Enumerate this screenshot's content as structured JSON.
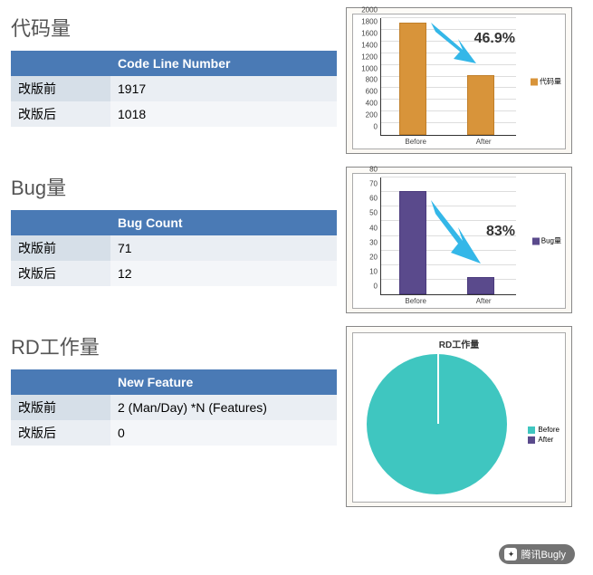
{
  "sections": {
    "code": {
      "title": "代码量",
      "header": "Code Line Number",
      "row1_label": "改版前",
      "row1_value": "1917",
      "row2_label": "改版后",
      "row2_value": "1018"
    },
    "bug": {
      "title": "Bug量",
      "header": "Bug Count",
      "row1_label": "改版前",
      "row1_value": "71",
      "row2_label": "改版后",
      "row2_value": "12"
    },
    "rd": {
      "title": "RD工作量",
      "header": "New Feature",
      "row1_label": "改版前",
      "row1_value": "2 (Man/Day) *N (Features)",
      "row2_label": "改版后",
      "row2_value": "0"
    }
  },
  "chart_data": [
    {
      "type": "bar",
      "categories": [
        "Before",
        "After"
      ],
      "values": [
        1917,
        1018
      ],
      "legend": "代码量",
      "ylim": [
        0,
        2000
      ],
      "yticks": [
        0,
        200,
        400,
        600,
        800,
        1000,
        1200,
        1400,
        1600,
        1800,
        2000
      ],
      "callout": "46.9%",
      "color": "#D8943A"
    },
    {
      "type": "bar",
      "categories": [
        "Before",
        "After"
      ],
      "values": [
        71,
        12
      ],
      "legend": "Bug量",
      "ylim": [
        0,
        80
      ],
      "yticks": [
        0,
        10,
        20,
        30,
        40,
        50,
        60,
        70,
        80
      ],
      "callout": "83%",
      "color": "#5A4A8C"
    },
    {
      "type": "pie",
      "title": "RD工作量",
      "series": [
        {
          "name": "Before",
          "value": 100,
          "color": "#3FC6C0"
        },
        {
          "name": "After",
          "value": 0,
          "color": "#5A4A8C"
        }
      ]
    }
  ],
  "watermark": "腾讯Bugly"
}
